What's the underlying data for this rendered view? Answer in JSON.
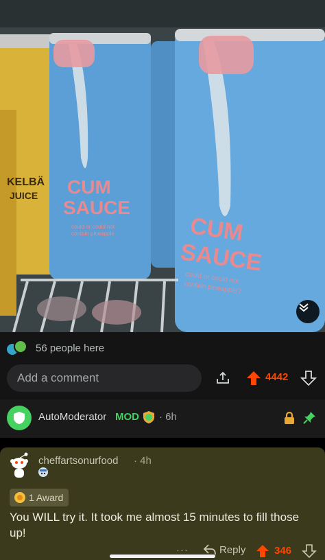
{
  "photo": {
    "can_left_text_line1": "KELBÄ",
    "can_left_text_line2": "JUICE",
    "can_center_title_line1": "CUM",
    "can_center_title_line2": "SAUCE",
    "can_center_tagline_line1": "could or could not",
    "can_center_tagline_line2": "contain pineapple",
    "can_right_title_line1": "CUM",
    "can_right_title_line2": "SAUCE",
    "can_right_tagline_line1": "could or could not",
    "can_right_tagline_line2": "contain pineapple?",
    "colors": {
      "can_blue": "#5b9fd6",
      "can_yellow": "#d9b23a",
      "title_pink": "#e88a8f"
    }
  },
  "post_bar": {
    "presence_text": "56 people here",
    "comment_placeholder": "Add a comment",
    "vote_count": "4442",
    "icons": [
      "share-icon",
      "upvote-icon",
      "downvote-icon"
    ]
  },
  "automod": {
    "name": "AutoModerator",
    "badge": "MOD",
    "time": "· 6h",
    "icons": [
      "shield-icon",
      "lock-icon",
      "pin-icon"
    ]
  },
  "comment": {
    "username": "cheffartsonurfood",
    "time": "· 4h",
    "award_label": "1 Award",
    "body": "You WILL try it. It took me almost 15 minutes to fill those up!",
    "more": "···",
    "reply_label": "Reply",
    "vote_count": "346"
  },
  "colors": {
    "accent": "#ff4500",
    "mod_green": "#46d160",
    "highlight_bg": "#3c3a1c",
    "page_bg": "#000000"
  }
}
